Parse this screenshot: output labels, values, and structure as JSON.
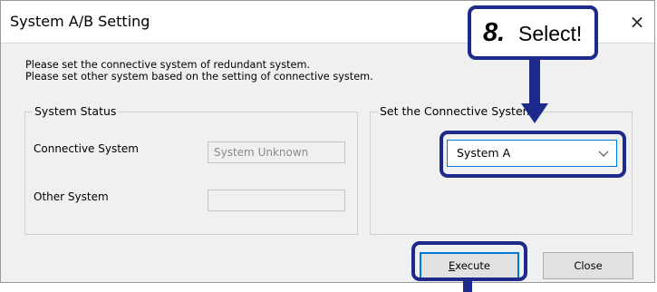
{
  "dialog": {
    "title": "System A/B Setting",
    "close_glyph": "×",
    "intro_line1": "Please set the connective system of redundant system.",
    "intro_line2": "Please set other system based on the setting of connective system."
  },
  "status_group": {
    "legend": "System Status",
    "connective_label": "Connective System",
    "connective_value": "System Unknown",
    "other_label": "Other System",
    "other_value": ""
  },
  "connective_group": {
    "legend": "Set the Connective System",
    "selected": "System A"
  },
  "buttons": {
    "execute_mnemonic": "E",
    "execute_rest": "xecute",
    "close": "Close"
  },
  "callout": {
    "step": "8.",
    "text": "Select!"
  },
  "colors": {
    "highlight": "#1d2a8c",
    "focus": "#0078d7"
  },
  "icons": {
    "close": "close-icon",
    "dropdown": "chevron-down-icon"
  }
}
